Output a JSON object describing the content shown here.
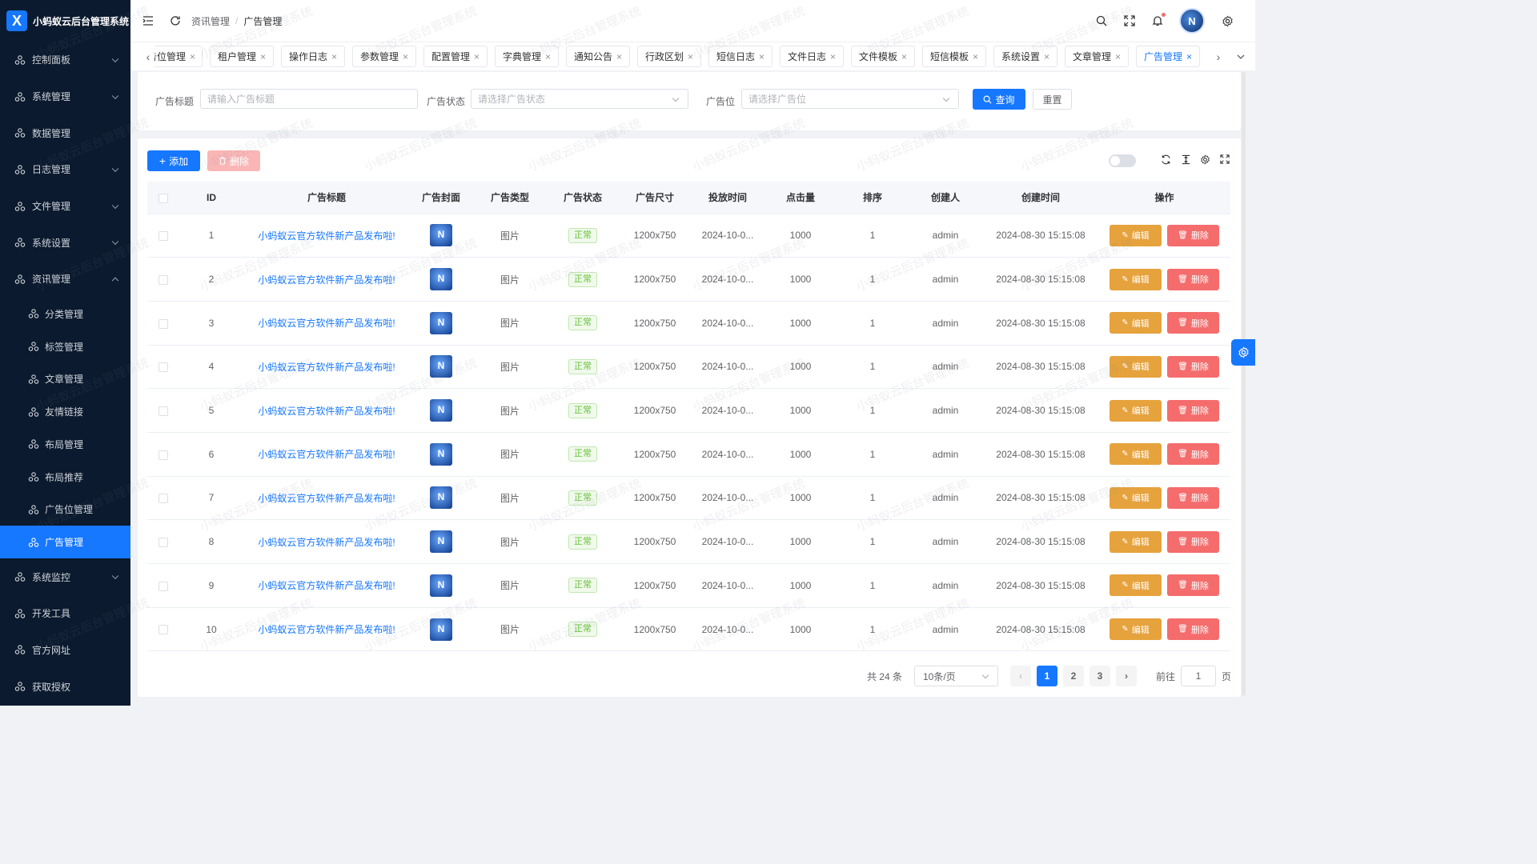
{
  "app": {
    "title": "小蚂蚁云后台管理系统",
    "logo_glyph": "X"
  },
  "sidebar": {
    "items": [
      {
        "label": "控制面板",
        "expand": "down"
      },
      {
        "label": "系统管理",
        "expand": "down"
      },
      {
        "label": "数据管理",
        "expand": ""
      },
      {
        "label": "日志管理",
        "expand": "down"
      },
      {
        "label": "文件管理",
        "expand": "down"
      },
      {
        "label": "系统设置",
        "expand": "down"
      },
      {
        "label": "资讯管理",
        "expand": "up"
      }
    ],
    "sub_items": [
      {
        "label": "分类管理",
        "active": false
      },
      {
        "label": "标签管理",
        "active": false
      },
      {
        "label": "文章管理",
        "active": false
      },
      {
        "label": "友情链接",
        "active": false
      },
      {
        "label": "布局管理",
        "active": false
      },
      {
        "label": "布局推荐",
        "active": false
      },
      {
        "label": "广告位管理",
        "active": false
      },
      {
        "label": "广告管理",
        "active": true
      }
    ],
    "items_after": [
      {
        "label": "系统监控",
        "expand": "down"
      },
      {
        "label": "开发工具",
        "expand": ""
      },
      {
        "label": "官方网址",
        "expand": ""
      },
      {
        "label": "获取授权",
        "expand": ""
      }
    ]
  },
  "header": {
    "breadcrumb": [
      "资讯管理",
      "广告管理"
    ],
    "separator": "/",
    "avatar_text": "N"
  },
  "tabs": [
    {
      "label": "广告位管理",
      "active": false
    },
    {
      "label": "租户管理",
      "active": false
    },
    {
      "label": "操作日志",
      "active": false
    },
    {
      "label": "参数管理",
      "active": false
    },
    {
      "label": "配置管理",
      "active": false
    },
    {
      "label": "字典管理",
      "active": false
    },
    {
      "label": "通知公告",
      "active": false
    },
    {
      "label": "行政区划",
      "active": false
    },
    {
      "label": "短信日志",
      "active": false
    },
    {
      "label": "文件日志",
      "active": false
    },
    {
      "label": "文件模板",
      "active": false
    },
    {
      "label": "短信模板",
      "active": false
    },
    {
      "label": "系统设置",
      "active": false
    },
    {
      "label": "文章管理",
      "active": false
    },
    {
      "label": "广告管理",
      "active": true
    }
  ],
  "search": {
    "title_label": "广告标题",
    "title_placeholder": "请输入广告标题",
    "status_label": "广告状态",
    "status_placeholder": "请选择广告状态",
    "position_label": "广告位",
    "position_placeholder": "请选择广告位",
    "query_label": "查询",
    "reset_label": "重置"
  },
  "toolbar": {
    "add_label": "添加",
    "delete_label": "删除"
  },
  "table": {
    "columns": [
      "",
      "ID",
      "广告标题",
      "广告封面",
      "广告类型",
      "广告状态",
      "广告尺寸",
      "投放时间",
      "点击量",
      "排序",
      "创建人",
      "创建时间",
      "操作"
    ],
    "rows": [
      {
        "id": "1",
        "title": "小蚂蚁云官方软件新产品发布啦!",
        "type": "图片",
        "status": "正常",
        "size": "1200x750",
        "time": "2024-10-0...",
        "clicks": "1000",
        "sort": "1",
        "creator": "admin",
        "created": "2024-08-30 15:15:08"
      },
      {
        "id": "2",
        "title": "小蚂蚁云官方软件新产品发布啦!",
        "type": "图片",
        "status": "正常",
        "size": "1200x750",
        "time": "2024-10-0...",
        "clicks": "1000",
        "sort": "1",
        "creator": "admin",
        "created": "2024-08-30 15:15:08"
      },
      {
        "id": "3",
        "title": "小蚂蚁云官方软件新产品发布啦!",
        "type": "图片",
        "status": "正常",
        "size": "1200x750",
        "time": "2024-10-0...",
        "clicks": "1000",
        "sort": "1",
        "creator": "admin",
        "created": "2024-08-30 15:15:08"
      },
      {
        "id": "4",
        "title": "小蚂蚁云官方软件新产品发布啦!",
        "type": "图片",
        "status": "正常",
        "size": "1200x750",
        "time": "2024-10-0...",
        "clicks": "1000",
        "sort": "1",
        "creator": "admin",
        "created": "2024-08-30 15:15:08"
      },
      {
        "id": "5",
        "title": "小蚂蚁云官方软件新产品发布啦!",
        "type": "图片",
        "status": "正常",
        "size": "1200x750",
        "time": "2024-10-0...",
        "clicks": "1000",
        "sort": "1",
        "creator": "admin",
        "created": "2024-08-30 15:15:08"
      },
      {
        "id": "6",
        "title": "小蚂蚁云官方软件新产品发布啦!",
        "type": "图片",
        "status": "正常",
        "size": "1200x750",
        "time": "2024-10-0...",
        "clicks": "1000",
        "sort": "1",
        "creator": "admin",
        "created": "2024-08-30 15:15:08"
      },
      {
        "id": "7",
        "title": "小蚂蚁云官方软件新产品发布啦!",
        "type": "图片",
        "status": "正常",
        "size": "1200x750",
        "time": "2024-10-0...",
        "clicks": "1000",
        "sort": "1",
        "creator": "admin",
        "created": "2024-08-30 15:15:08"
      },
      {
        "id": "8",
        "title": "小蚂蚁云官方软件新产品发布啦!",
        "type": "图片",
        "status": "正常",
        "size": "1200x750",
        "time": "2024-10-0...",
        "clicks": "1000",
        "sort": "1",
        "creator": "admin",
        "created": "2024-08-30 15:15:08"
      },
      {
        "id": "9",
        "title": "小蚂蚁云官方软件新产品发布啦!",
        "type": "图片",
        "status": "正常",
        "size": "1200x750",
        "time": "2024-10-0...",
        "clicks": "1000",
        "sort": "1",
        "creator": "admin",
        "created": "2024-08-30 15:15:08"
      },
      {
        "id": "10",
        "title": "小蚂蚁云官方软件新产品发布啦!",
        "type": "图片",
        "status": "正常",
        "size": "1200x750",
        "time": "2024-10-0...",
        "clicks": "1000",
        "sort": "1",
        "creator": "admin",
        "created": "2024-08-30 15:15:08"
      }
    ],
    "edit_label": "编辑",
    "delete_label": "删除"
  },
  "pagination": {
    "total_text": "共 24 条",
    "page_size": "10条/页",
    "pages": [
      "1",
      "2",
      "3"
    ],
    "current": "1",
    "goto_label": "前往",
    "goto_value": "1",
    "page_unit": "页"
  },
  "watermark_text": "小蚂蚁云后台管理系统",
  "colors": {
    "primary": "#1677ff",
    "sidebar_bg": "#0b1a2e",
    "warning": "#e6a23c",
    "danger": "#f56c6c",
    "success": "#67c23a"
  }
}
